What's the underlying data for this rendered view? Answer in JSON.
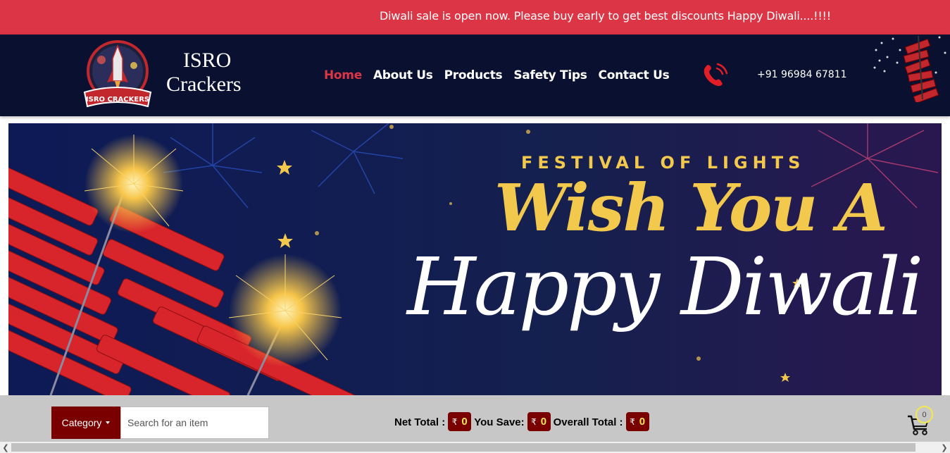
{
  "announcement": {
    "text": "Diwali sale is open now. Please buy early to get best discounts Happy Diwali....!!!!"
  },
  "header": {
    "logo_text": "ISRO CRACKERS",
    "brand_line1": "ISRO",
    "brand_line2": "Crackers",
    "nav": [
      {
        "label": "Home",
        "active": true
      },
      {
        "label": "About Us",
        "active": false
      },
      {
        "label": "Products",
        "active": false
      },
      {
        "label": "Safety Tips",
        "active": false
      },
      {
        "label": "Contact Us",
        "active": false
      }
    ],
    "phone_icon": "phone-ringing-icon",
    "phone": "+91 96984 67811"
  },
  "banner": {
    "line1": "FESTIVAL OF LIGHTS",
    "line2": "Wish You A",
    "line3": "Happy Diwali"
  },
  "toolbar": {
    "category_label": "Category",
    "search_placeholder": "Search for an item",
    "net_total_label": "Net Total :",
    "net_total_value": "0",
    "you_save_label": "You Save:",
    "you_save_value": "0",
    "overall_total_label": "Overall Total :",
    "overall_total_value": "0",
    "currency_symbol": "₹",
    "cart_count": "0",
    "cart_icon": "shopping-cart-icon"
  },
  "colors": {
    "accent_red": "#dc3545",
    "header_navy": "#0a1130",
    "dark_red": "#7a0000",
    "gold": "#f2c94c"
  }
}
